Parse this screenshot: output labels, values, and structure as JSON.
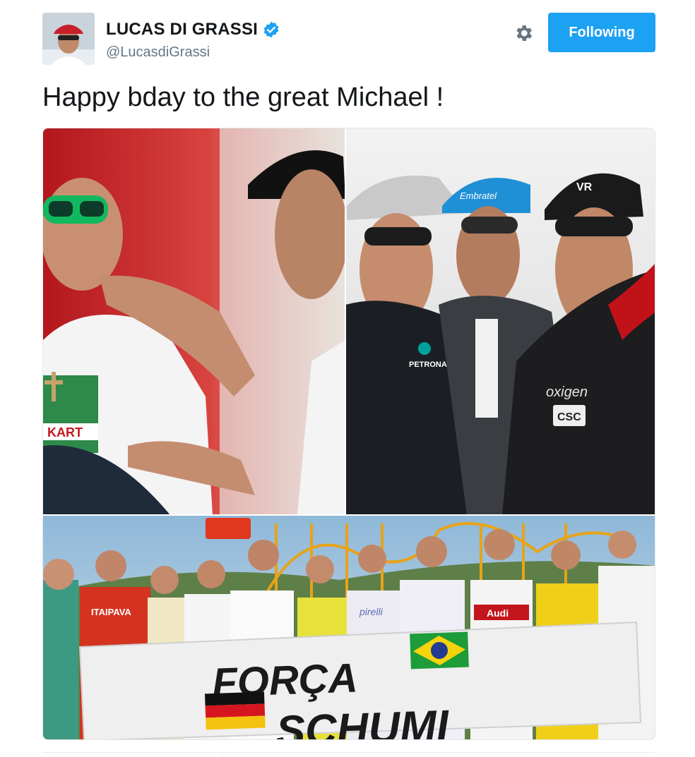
{
  "user": {
    "display_name": "LUCAS DI GRASSI",
    "handle": "@LucasdiGrassi",
    "verified": true,
    "avatar_icon": "profile-photo"
  },
  "actions": {
    "settings_icon": "gear-icon",
    "follow_label": "Following"
  },
  "tweet": {
    "text": "Happy bday to the great Michael !"
  },
  "photo": {
    "logo_text": {
      "kart": "KART",
      "petronas": "PETRONAS",
      "embratel": "Embratel",
      "vr": "VR",
      "oxigen": "oxigen",
      "csc": "CSC",
      "itaipava": "ITAIPAVA",
      "audi": "Audi",
      "pirelli": "pirelli"
    },
    "banner": {
      "line1": "FORÇA",
      "line2": "SCHUMI"
    }
  },
  "colors": {
    "accent": "#1da1f2",
    "text": "#14171a",
    "secondary": "#657786",
    "border": "#e1e8ed"
  }
}
